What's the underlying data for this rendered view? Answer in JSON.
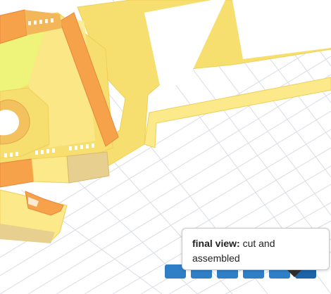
{
  "viewer": {
    "colors": {
      "background": "#ffffff",
      "grid": "#d9dde3",
      "part_light": "#fbe98a",
      "part_yellow": "#f7df6f",
      "part_lime": "#eef37a",
      "part_orange": "#f5a24a",
      "part_orange_dark": "#ee8a33",
      "part_tan": "#e7cf8f",
      "step_button": "#2f7fc7",
      "step_button_active": "#1f63a7"
    },
    "steps": {
      "count": 6,
      "active_index": 5
    },
    "tooltip": {
      "title": "final view:",
      "text": " cut and assembled"
    }
  }
}
